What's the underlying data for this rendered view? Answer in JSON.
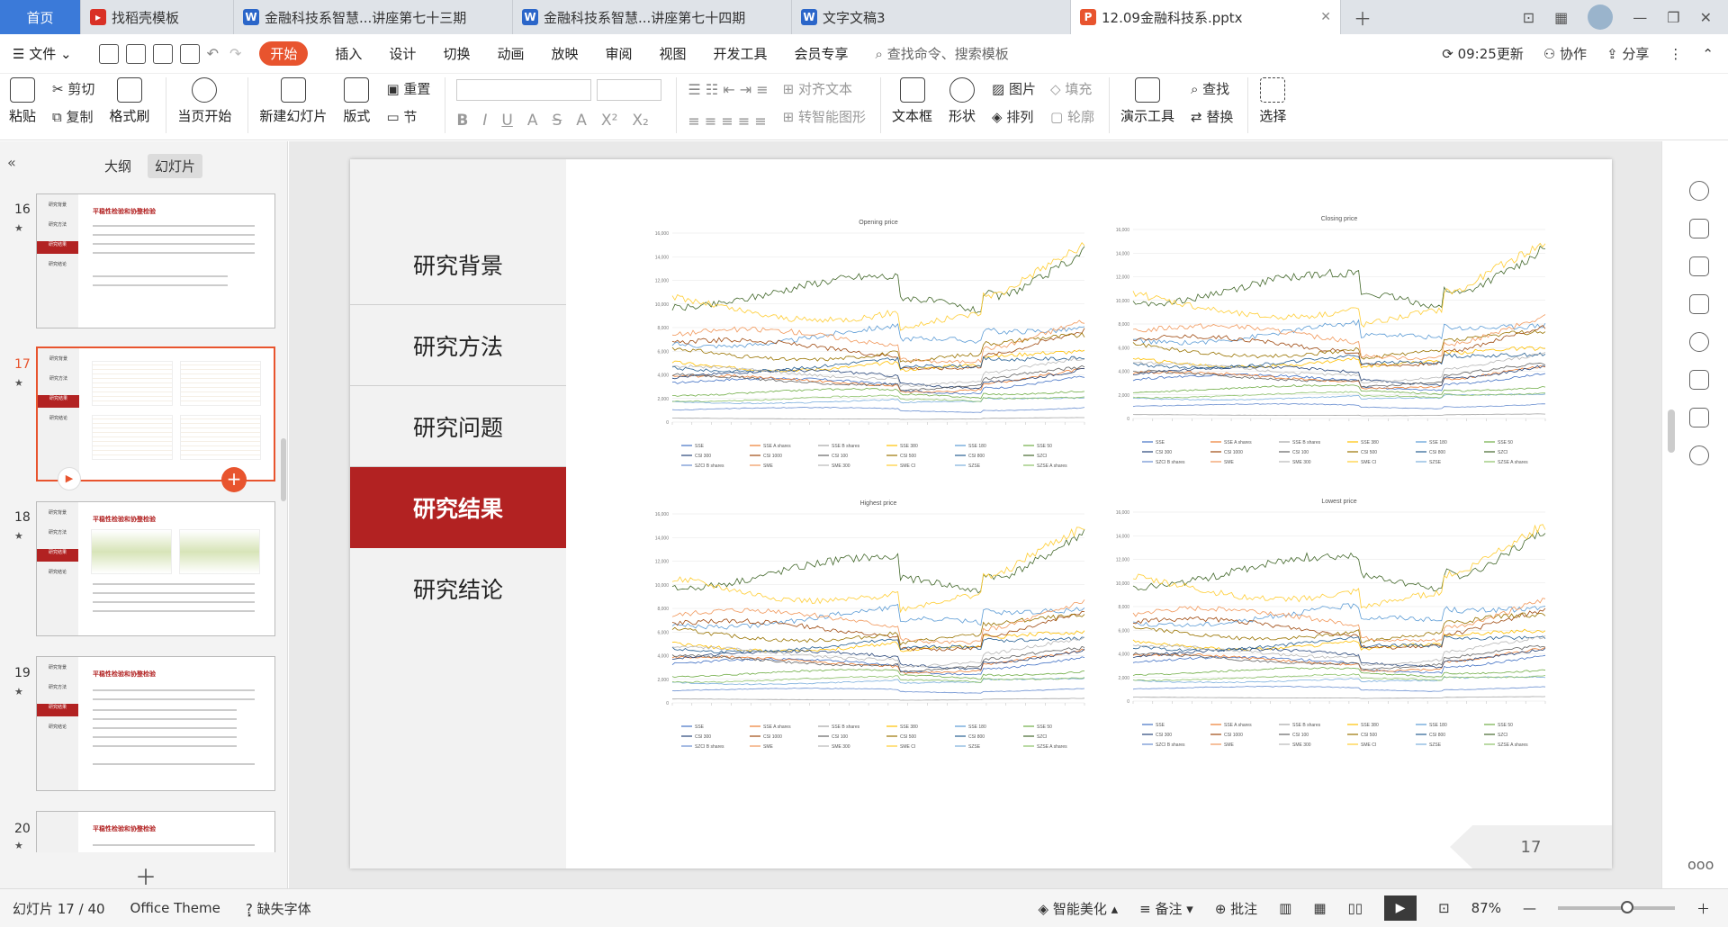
{
  "tabs": [
    {
      "label": "首页",
      "type": "home"
    },
    {
      "label": "找稻壳模板",
      "icon": "daoke-icon",
      "color": "#d93025"
    },
    {
      "label": "金融科技系智慧...讲座第七十三期",
      "icon": "word-icon",
      "color": "#2b66c9"
    },
    {
      "label": "金融科技系智慧...讲座第七十四期",
      "icon": "word-icon",
      "color": "#2b66c9"
    },
    {
      "label": "文字文稿3",
      "icon": "word-icon",
      "color": "#2b66c9"
    },
    {
      "label": "12.09金融科技系.pptx",
      "icon": "ppt-icon",
      "color": "#e8542e",
      "active": true
    }
  ],
  "menu": {
    "file": "文件",
    "items": [
      "开始",
      "插入",
      "设计",
      "切换",
      "动画",
      "放映",
      "审阅",
      "视图",
      "开发工具",
      "会员专享"
    ],
    "active": "开始",
    "search": "查找命令、搜索模板",
    "update": "09:25更新",
    "collab": "协作",
    "share": "分享"
  },
  "ribbon": {
    "paste": "粘贴",
    "cut": "剪切",
    "copy": "复制",
    "format_painter": "格式刷",
    "from_current": "当页开始",
    "new_slide": "新建幻灯片",
    "layout": "版式",
    "reset": "重置",
    "section": "节",
    "align_text": "对齐文本",
    "smart_shape": "转智能图形",
    "textbox": "文本框",
    "shape": "形状",
    "picture": "图片",
    "arrange": "排列",
    "fill": "填充",
    "outline": "轮廓",
    "present_tools": "演示工具",
    "find": "查找",
    "replace": "替换",
    "select": "选择"
  },
  "leftpanel": {
    "outline_tab": "大纲",
    "slides_tab": "幻灯片",
    "thumbs": [
      {
        "num": "16",
        "title": "平稳性检验和协整检验"
      },
      {
        "num": "17",
        "title": "",
        "selected": true
      },
      {
        "num": "18",
        "title": "平稳性检验和协整检验"
      },
      {
        "num": "19",
        "title": "平稳性检验和协整检验"
      },
      {
        "num": "20",
        "title": "平稳性检验和协整检验"
      }
    ],
    "nav_items": [
      "研究背景",
      "研究方法",
      "研究结果",
      "研究结论"
    ]
  },
  "slide": {
    "nav": [
      "研究背景",
      "研究方法",
      "研究问题",
      "研究结果",
      "研究结论"
    ],
    "current": "研究结果",
    "page_number": "17"
  },
  "chart_data": [
    {
      "type": "line",
      "title": "Opening price",
      "ylim": [
        0,
        16000
      ],
      "yticks": [
        "0",
        "2,000",
        "4,000",
        "6,000",
        "8,000",
        "10,000",
        "12,000",
        "14,000",
        "16,000"
      ],
      "legend": [
        "SSE",
        "SSE A shares",
        "SSE B shares",
        "SSE 380",
        "SSE 180",
        "SSE 50",
        "CSI 300",
        "CSI 1000",
        "CSI 100",
        "CSI 500",
        "CSI 800",
        "SZCI",
        "SZCI B shares",
        "SME",
        "SME 300",
        "SME CI",
        "SZSE",
        "SZSE A shares"
      ]
    },
    {
      "type": "line",
      "title": "Closing price",
      "ylim": [
        0,
        16000
      ],
      "yticks": [
        "0",
        "2,000",
        "4,000",
        "6,000",
        "8,000",
        "10,000",
        "12,000",
        "14,000",
        "16,000"
      ],
      "legend": [
        "SSE",
        "SSE A shares",
        "SSE B shares",
        "SSE 380",
        "SSE 180",
        "SSE 50",
        "CSI 300",
        "CSI 1000",
        "CSI 100",
        "CSI 500",
        "CSI 800",
        "SZCI",
        "SZCI B shares",
        "SME",
        "SME 300",
        "SME CI",
        "SZSE",
        "SZSE A shares"
      ]
    },
    {
      "type": "line",
      "title": "Highest price",
      "ylim": [
        0,
        16000
      ],
      "yticks": [
        "0",
        "2,000",
        "4,000",
        "6,000",
        "8,000",
        "10,000",
        "12,000",
        "14,000",
        "16,000"
      ],
      "legend": [
        "SSE",
        "SSE A shares",
        "SSE B shares",
        "SSE 380",
        "SSE 180",
        "SSE 50",
        "CSI 300",
        "CSI 1000",
        "CSI 100",
        "CSI 500",
        "CSI 800",
        "SZCI",
        "SZCI B shares",
        "SME",
        "SME 300",
        "SME CI",
        "SZSE",
        "SZSE A shares"
      ]
    },
    {
      "type": "line",
      "title": "Lowest price",
      "ylim": [
        0,
        16000
      ],
      "yticks": [
        "0",
        "2,000",
        "4,000",
        "6,000",
        "8,000",
        "10,000",
        "12,000",
        "14,000",
        "16,000"
      ],
      "legend": [
        "SSE",
        "SSE A shares",
        "SSE B shares",
        "SSE 380",
        "SSE 180",
        "SSE 50",
        "CSI 300",
        "CSI 1000",
        "CSI 100",
        "CSI 500",
        "CSI 800",
        "SZCI",
        "SZCI B shares",
        "SME",
        "SME 300",
        "SME CI",
        "SZSE",
        "SZSE A shares"
      ]
    }
  ],
  "series_colors": [
    "#4472c4",
    "#ed7d31",
    "#a5a5a5",
    "#ffc000",
    "#5b9bd5",
    "#70ad47",
    "#264478",
    "#9e480e",
    "#636363",
    "#997300",
    "#255e91",
    "#43682b",
    "#698ed0",
    "#f1975a",
    "#b7b7b7",
    "#ffcd33",
    "#7cafdd",
    "#8cc168"
  ],
  "status": {
    "slide_info": "幻灯片 17 / 40",
    "theme": "Office Theme",
    "missing_font": "缺失字体",
    "beautify": "智能美化",
    "notes": "备注",
    "comment": "批注",
    "zoom": "87%"
  }
}
